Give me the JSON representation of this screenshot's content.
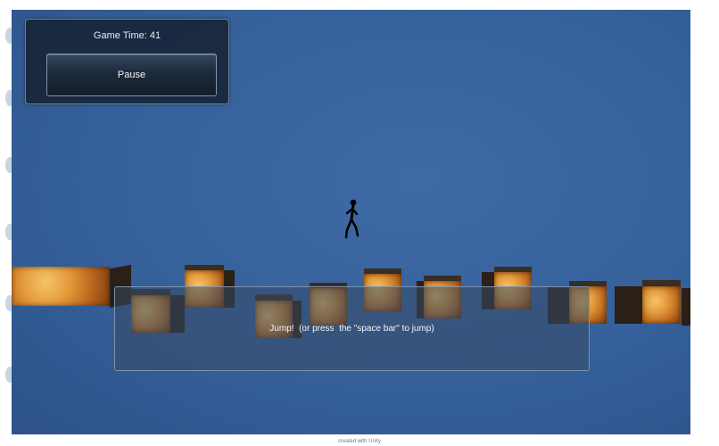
{
  "hud": {
    "game_time_label": "Game Time: 41",
    "pause_label": "Pause"
  },
  "jump_panel": {
    "hint": "Jump!  (or press  the \"space bar\" to jump)"
  },
  "footer": {
    "text": "created with Unity"
  },
  "scene": {
    "player_icon": "stickman-icon",
    "block_icon": "crate-icon"
  }
}
